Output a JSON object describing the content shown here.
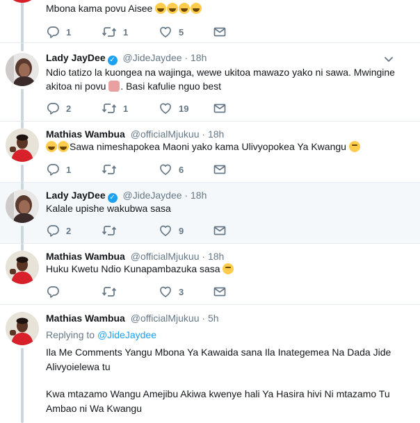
{
  "tweets": [
    {
      "text": "Mbona kama povu Aisee",
      "emojis": [
        "face-with-tears-of-joy",
        "face-with-tears-of-joy",
        "face-with-tears-of-joy",
        "face-with-tears-of-joy"
      ],
      "replies": "1",
      "retweets": "1",
      "likes": "5"
    },
    {
      "name": "Lady JayDee",
      "handle": "@JideJaydee",
      "time": "18h",
      "verified": true,
      "text": "Ndio tatizo la kuongea na wajinga, wewe ukitoa mawazo yako ni sawa. Mwingine akitoa ni povu",
      "text2": ". Basi kafulie nguo best",
      "replies": "2",
      "retweets": "1",
      "likes": "19"
    },
    {
      "name": "Mathias Wambua",
      "handle": "@officialMjukuu",
      "time": "18h",
      "text": "Sawa nimeshapokea Maoni yako kama Ulivyopokea Ya Kwangu",
      "replies": "1",
      "retweets": "",
      "likes": "6"
    },
    {
      "name": "Lady JayDee",
      "handle": "@JideJaydee",
      "time": "18h",
      "verified": true,
      "text": "Kalale upishe wakubwa sasa",
      "replies": "2",
      "retweets": "",
      "likes": "9"
    },
    {
      "name": "Mathias Wambua",
      "handle": "@officialMjukuu",
      "time": "18h",
      "text": "Huku Kwetu Ndio Kunapambazuka sasa",
      "replies": "",
      "retweets": "",
      "likes": "3"
    },
    {
      "name": "Mathias Wambua",
      "handle": "@officialMjukuu",
      "time": "5h",
      "replying_label": "Replying to",
      "replying_to": "@JideJaydee",
      "text": "Ila Me Comments Yangu Mbona Ya Kawaida sana Ila Inategemea Na Dada Jide Alivyoielewa tu",
      "text2": "Kwa mtazamo Wangu Amejibu Akiwa kwenye hali Ya Hasira hivi Ni mtazamo Tu Ambao ni Wa Kwangu"
    }
  ],
  "separator": "·",
  "colors": {
    "accent": "#1da1f2",
    "muted": "#657786",
    "thread": "#ccd6dd",
    "highlight_bg": "#f5f8fa"
  }
}
